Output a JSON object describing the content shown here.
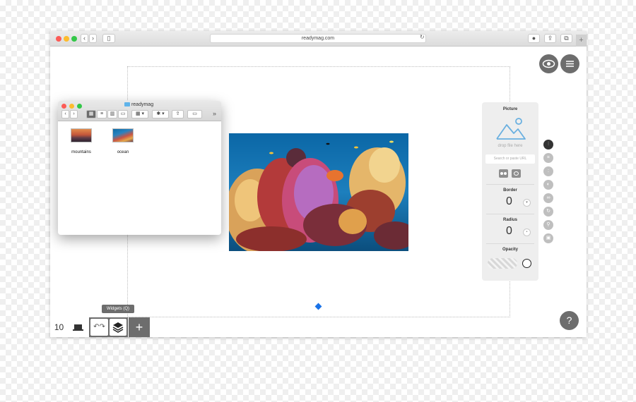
{
  "browser": {
    "url": "readymag.com",
    "newtab": "+"
  },
  "finder": {
    "title": "readymag",
    "overflow": "»",
    "files": [
      {
        "label": "mountains"
      },
      {
        "label": "ocean"
      }
    ]
  },
  "panel": {
    "picture_label": "Picture",
    "drop_text": "drop file here",
    "search_placeholder": "Search or paste URL",
    "border_label": "Border",
    "border_value": "0",
    "radius_label": "Radius",
    "radius_value": "0",
    "opacity_label": "Opacity"
  },
  "tools": [
    "sliders-icon",
    "crop-icon",
    "ratio-icon",
    "mask-icon",
    "link-icon",
    "rotate-icon",
    "pin-icon",
    "lock-icon"
  ],
  "bottombar": {
    "page_number": "10",
    "tooltip": "Widgets (Q)",
    "add": "+"
  },
  "help": "?",
  "colors": {
    "accent": "#1a73e8",
    "button_grey": "#6d6d6d"
  }
}
